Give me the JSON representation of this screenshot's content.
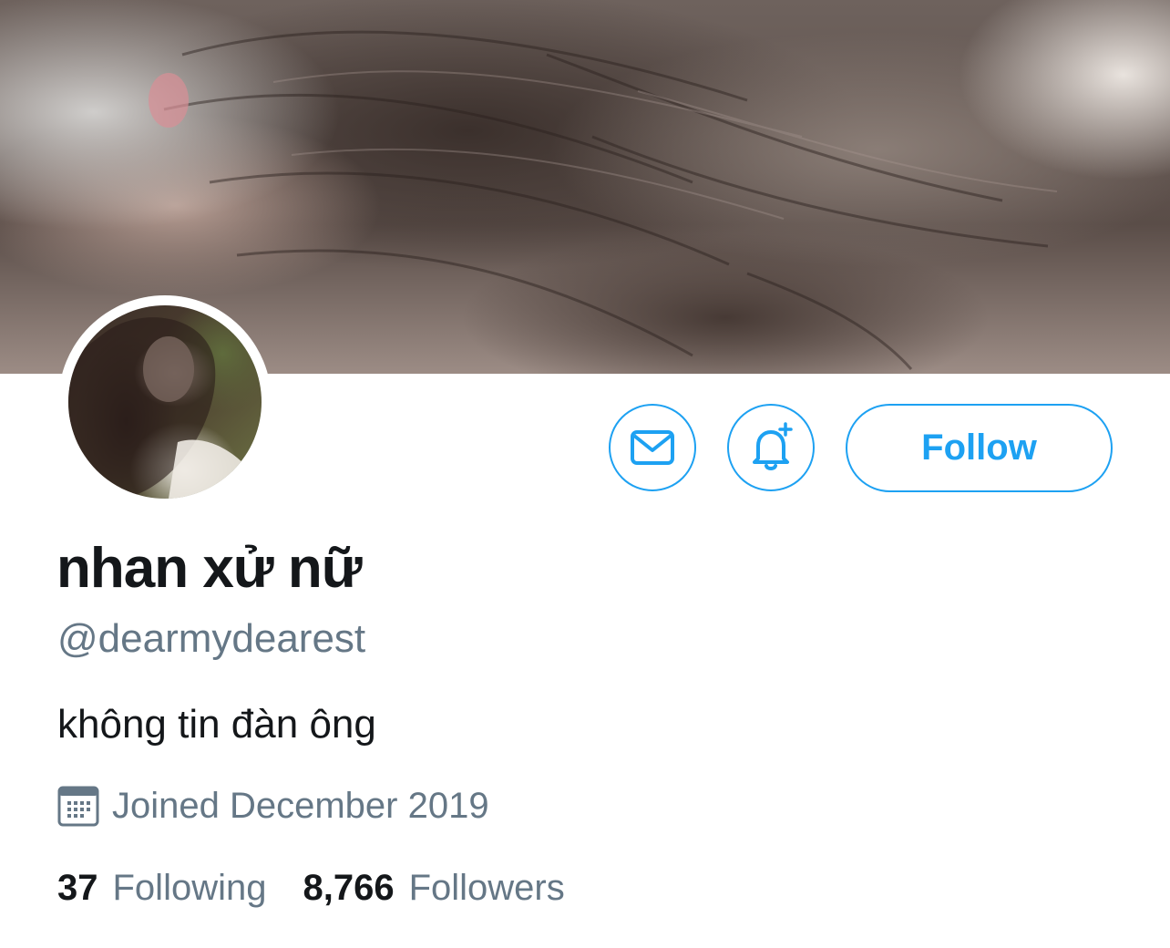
{
  "profile": {
    "display_name": "nhan xử nữ",
    "handle": "@dearmydearest",
    "bio": "không tin đàn ông",
    "joined": "Joined December 2019"
  },
  "stats": {
    "following_count": "37",
    "following_label": "Following",
    "followers_count": "8,766",
    "followers_label": "Followers"
  },
  "actions": {
    "follow_label": "Follow",
    "message_icon": "envelope-icon",
    "notify_icon": "bell-plus-icon"
  },
  "icons": {
    "joined": "calendar-icon"
  },
  "colors": {
    "accent": "#1da1f2",
    "secondary_text": "#657786",
    "primary_text": "#14171a"
  }
}
